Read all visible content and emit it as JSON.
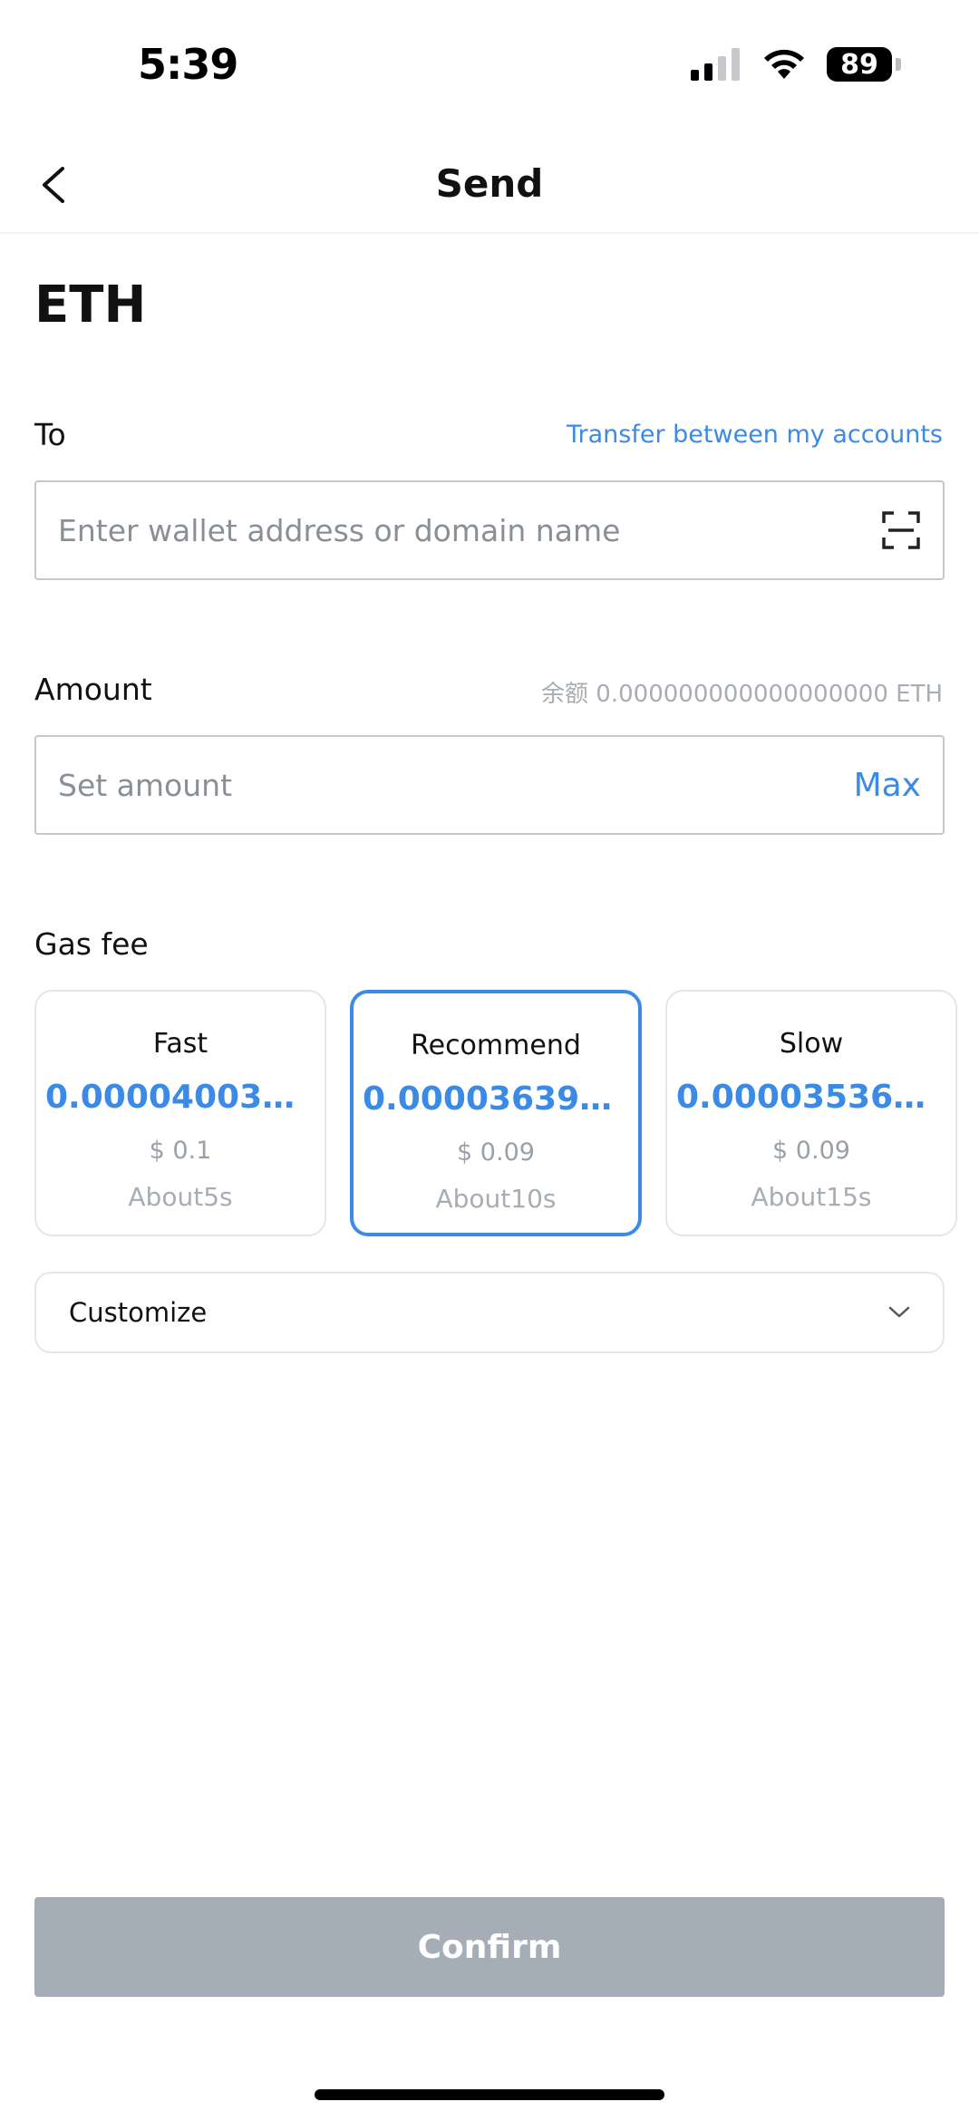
{
  "status_bar": {
    "time": "5:39",
    "battery": "89"
  },
  "nav": {
    "title": "Send"
  },
  "coin": "ETH",
  "to": {
    "label": "To",
    "transfer_link": "Transfer between my accounts",
    "placeholder": "Enter wallet address or domain name"
  },
  "amount": {
    "label": "Amount",
    "balance": "余额 0.000000000000000000 ETH",
    "placeholder": "Set amount",
    "max_label": "Max"
  },
  "gas": {
    "label": "Gas fee",
    "options": [
      {
        "name": "Fast",
        "value": "0.0000400356...",
        "usd": "$ 0.1",
        "time": "About5s",
        "selected": false
      },
      {
        "name": "Recommend",
        "value": "0.0000363960...",
        "usd": "$ 0.09",
        "time": "About10s",
        "selected": true
      },
      {
        "name": "Slow",
        "value": "0.0000353670...",
        "usd": "$ 0.09",
        "time": "About15s",
        "selected": false
      }
    ]
  },
  "customize": {
    "label": "Customize"
  },
  "confirm_label": "Confirm",
  "colors": {
    "accent": "#3b8ae6",
    "disabled_button": "#a5aeb7"
  }
}
